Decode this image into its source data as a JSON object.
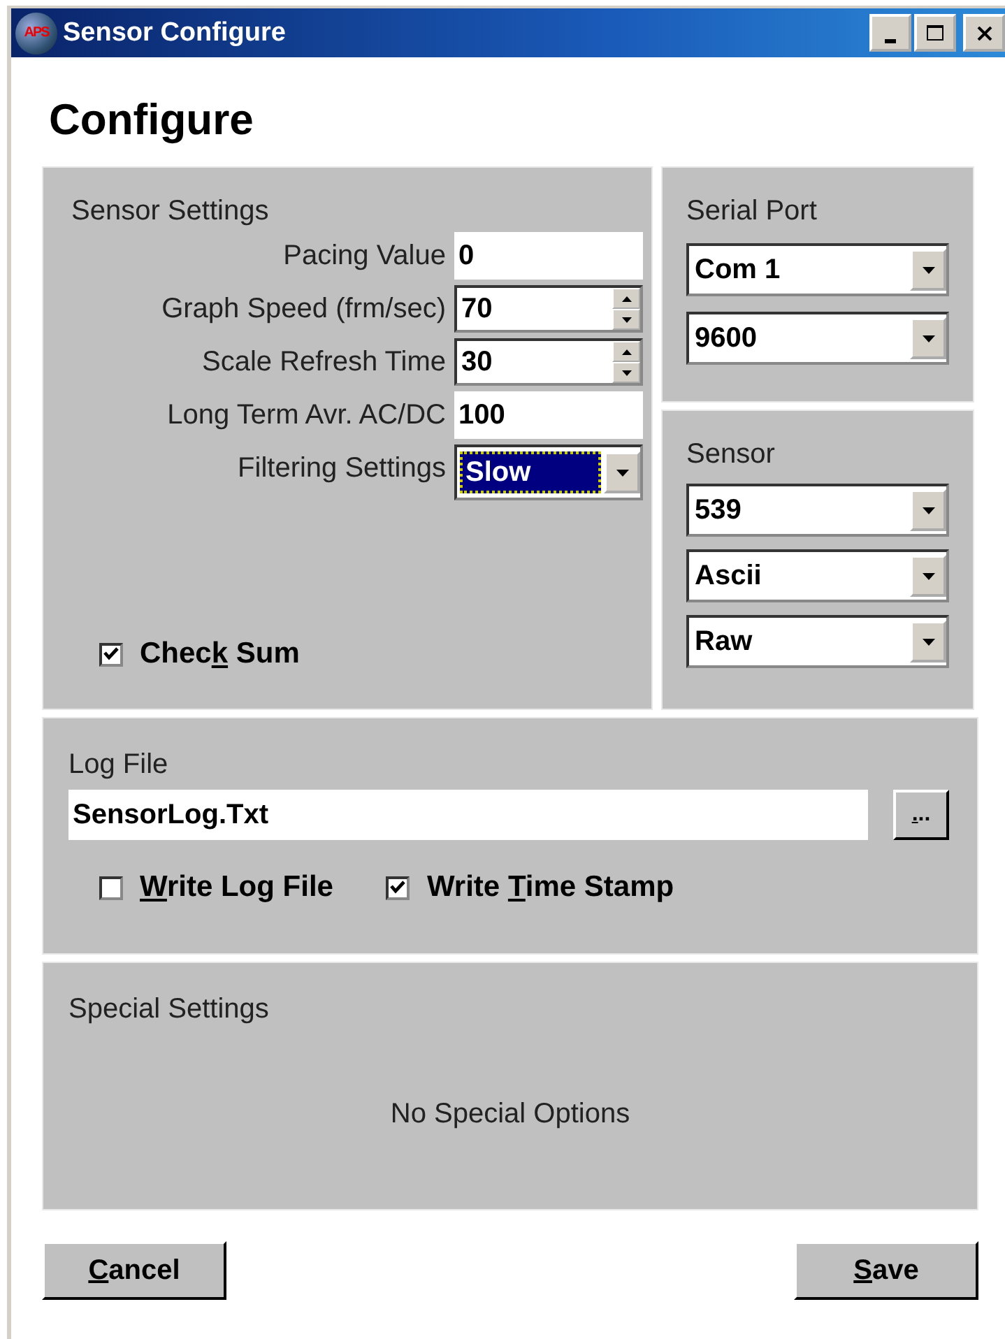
{
  "window": {
    "title": "Sensor Configure",
    "icon_label": "APS"
  },
  "heading": "Configure",
  "sensor_settings": {
    "title": "Sensor Settings",
    "fields": [
      {
        "label": "Pacing Value",
        "value": "0",
        "kind": "text",
        "focused": false
      },
      {
        "label": "Graph Speed (frm/sec)",
        "value": "70",
        "kind": "spin",
        "focused": false
      },
      {
        "label": "Scale Refresh Time",
        "value": "30",
        "kind": "spin",
        "focused": false
      },
      {
        "label": "Long Term Avr. AC/DC",
        "value": "100",
        "kind": "text",
        "focused": false
      },
      {
        "label": "Filtering Settings",
        "value": "Slow",
        "kind": "dropdown",
        "focused": true
      }
    ],
    "check_sum": {
      "label_before": "Chec",
      "access_key": "k",
      "label_after": " Sum",
      "checked": true
    }
  },
  "serial_port": {
    "title": "Serial Port",
    "dropdowns": [
      {
        "value": "Com 1"
      },
      {
        "value": "9600"
      }
    ]
  },
  "sensor": {
    "title": "Sensor",
    "dropdowns": [
      {
        "value": "539"
      },
      {
        "value": "Ascii"
      },
      {
        "value": "Raw"
      }
    ]
  },
  "log_file": {
    "title": "Log File",
    "value": "SensorLog.Txt",
    "browse_button": {
      "access_key": ".",
      "label_after": ".."
    },
    "options": [
      {
        "access_key": "W",
        "label_after": "rite Log File",
        "checked": false
      },
      {
        "label_before": "Write ",
        "access_key": "T",
        "label_after": "ime Stamp",
        "checked": true
      }
    ]
  },
  "special_settings": {
    "title": "Special Settings",
    "message": "No Special Options"
  },
  "buttons": [
    {
      "access_key": "C",
      "label_after": "ancel"
    },
    {
      "access_key": "S",
      "label_after": "ave"
    }
  ]
}
